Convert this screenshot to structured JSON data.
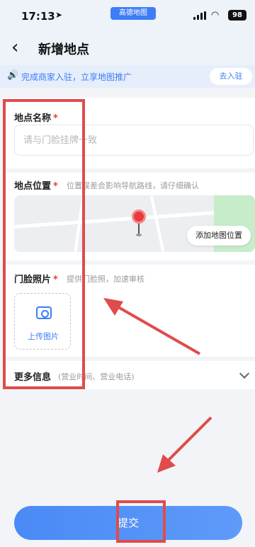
{
  "status_bar": {
    "time": "17:13",
    "app_badge": "高德地图",
    "battery": "98"
  },
  "nav": {
    "title": "新增地点"
  },
  "banner": {
    "text": "完成商家入驻，立享地图推广",
    "button": "去入驻"
  },
  "form": {
    "name": {
      "label": "地点名称",
      "required_mark": "*",
      "placeholder": "请与门脸挂牌一致",
      "value": ""
    },
    "location": {
      "label": "地点位置",
      "required_mark": "*",
      "hint": "位置误差会影响导航路线，请仔细确认",
      "map_button": "添加地图位置"
    },
    "photo": {
      "label": "门脸照片",
      "required_mark": "*",
      "hint": "提供门脸照，加速审核",
      "upload_label": "上传图片"
    },
    "more": {
      "label": "更多信息",
      "hint": "(营业时间、营业电话)"
    }
  },
  "submit": {
    "label": "提交"
  },
  "colors": {
    "accent": "#3d7df5",
    "required": "#e5412d",
    "annotation": "#e04b4b"
  },
  "icons": {
    "back": "chevron-left-icon",
    "speaker": "speaker-icon",
    "camera": "camera-icon",
    "expand": "chevron-down-icon",
    "location": "map-pin-icon"
  }
}
